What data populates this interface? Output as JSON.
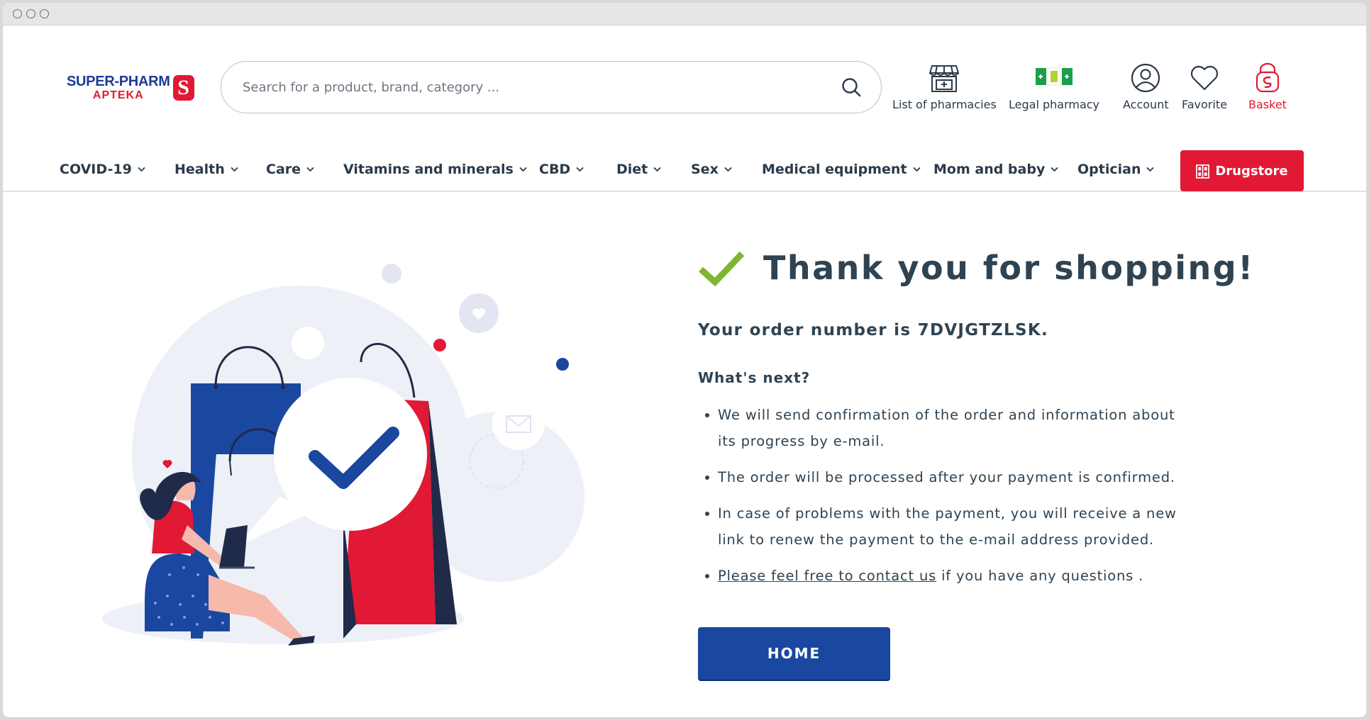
{
  "brand": {
    "name_top": "SUPER-PHARM",
    "name_bottom": "APTEKA",
    "mark": "S",
    "colors": {
      "blue": "#1f3a93",
      "red": "#e11934",
      "green": "#7cb82f"
    }
  },
  "search": {
    "placeholder": "Search for a product, brand, category ...",
    "icon": "search-icon"
  },
  "header_actions": [
    {
      "label": "List of pharmacies",
      "icon": "pharmacy-store-icon"
    },
    {
      "label": "Legal pharmacy",
      "icon": "legal-pharmacy-flag-icon"
    },
    {
      "label": "Account",
      "icon": "user-icon"
    },
    {
      "label": "Favorite",
      "icon": "heart-icon"
    },
    {
      "label": "Basket",
      "icon": "basket-icon"
    }
  ],
  "nav": {
    "items": [
      "COVID-19",
      "Health",
      "Care",
      "Vitamins and minerals",
      "CBD",
      "Diet",
      "Sex",
      "Medical equipment",
      "Mom and baby",
      "Optician"
    ],
    "drugstore_label": "Drugstore",
    "drugstore_icon": "drugstore-icon"
  },
  "confirmation": {
    "title": "Thank you for shopping!",
    "order_prefix": "Your order number is ",
    "order_number": "7DVJGTZLSK",
    "order_suffix": ".",
    "next_title": "What's next?",
    "next_items": [
      "We will send confirmation of the order and information about its progress by e-mail.",
      "The order will be processed after your payment is confirmed.",
      "In case of problems with the payment, you will receive a new link to renew the payment to the e-mail address provided."
    ],
    "contact_link": "Please feel free to contact us",
    "contact_suffix": " if you have any questions .",
    "home_button": "HOME"
  }
}
